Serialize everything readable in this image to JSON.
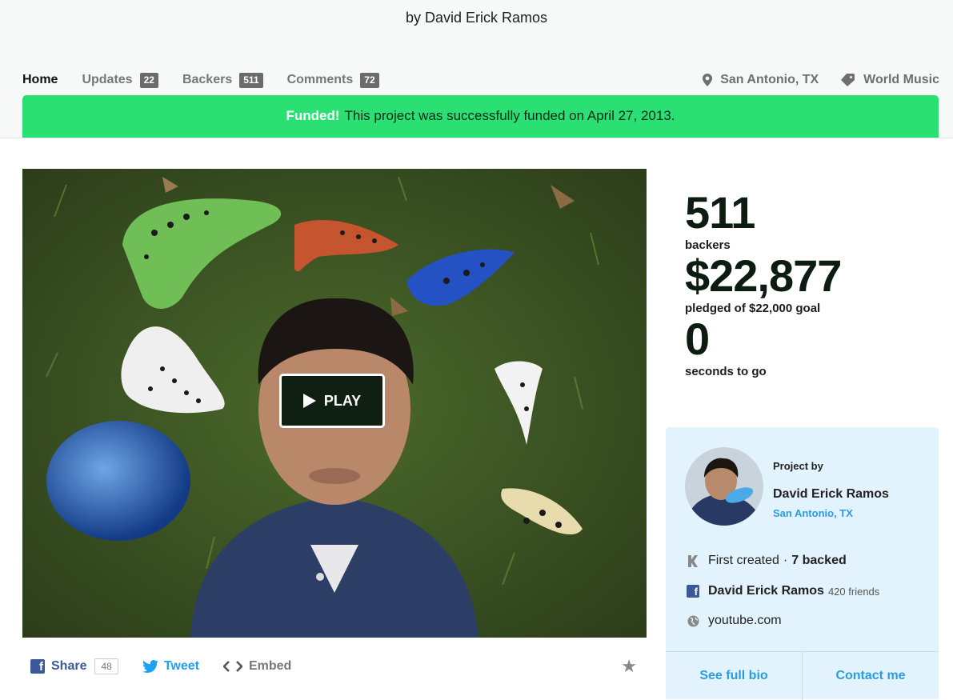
{
  "header": {
    "byline": "by David Erick Ramos"
  },
  "nav": {
    "items": [
      {
        "label": "Home"
      },
      {
        "label": "Updates",
        "count": "22"
      },
      {
        "label": "Backers",
        "count": "511"
      },
      {
        "label": "Comments",
        "count": "72"
      }
    ],
    "location": "San Antonio, TX",
    "category": "World Music"
  },
  "funded": {
    "label": "Funded!",
    "message": "This project was successfully funded on April 27, 2013."
  },
  "video": {
    "play_label": "PLAY"
  },
  "share": {
    "share_label": "Share",
    "share_count": "48",
    "tweet_label": "Tweet",
    "embed_label": "Embed"
  },
  "stats": {
    "backers": "511",
    "backers_label": "backers",
    "pledged": "$22,877",
    "pledged_label": "pledged of $22,000 goal",
    "time": "0",
    "time_label": "seconds to go"
  },
  "creator": {
    "project_by": "Project by",
    "name": "David Erick Ramos",
    "location": "San Antonio, TX",
    "first_created": "First created",
    "separator": "·",
    "backed": "7 backed",
    "facebook_name": "David Erick Ramos",
    "friends": "420 friends",
    "website": "youtube.com",
    "bio_button": "See full bio",
    "contact_button": "Contact me"
  },
  "colors": {
    "funded_bar": "#2ae072",
    "link_blue": "#2b9ce2",
    "facebook_blue": "#3b5998",
    "twitter_blue": "#1da1f2",
    "creator_panel": "#e3f3fd"
  }
}
